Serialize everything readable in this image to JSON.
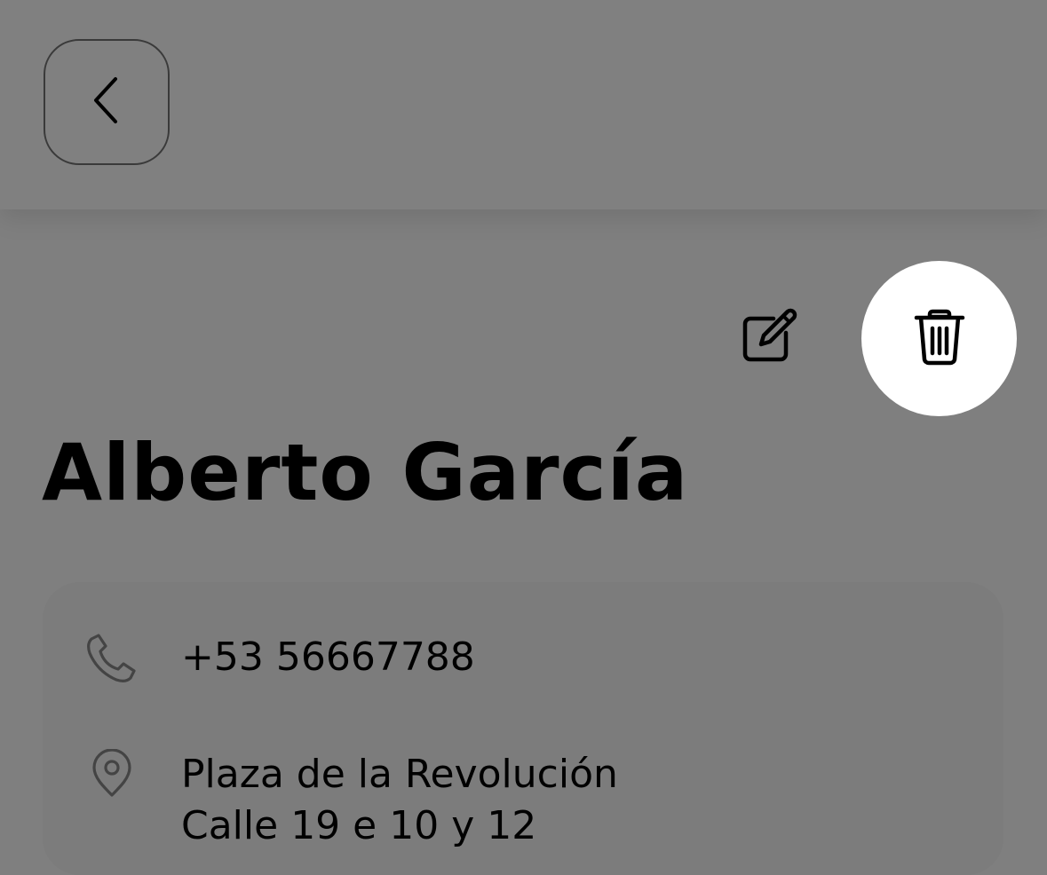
{
  "header": {
    "back_icon": "chevron-left-icon"
  },
  "actions": {
    "edit_icon": "pencil-square-icon",
    "delete_icon": "trash-icon"
  },
  "contact": {
    "name": "Alberto García",
    "phone": "+53 56667788",
    "address_line1": "Plaza de la Revolución",
    "address_line2": "Calle 19 e 10 y 12"
  },
  "icons": {
    "phone": "phone-icon",
    "address": "map-pin-icon"
  },
  "colors": {
    "overlay_background": "#7f7f7f",
    "delete_highlight": "#ffffff",
    "text": "#000000"
  }
}
